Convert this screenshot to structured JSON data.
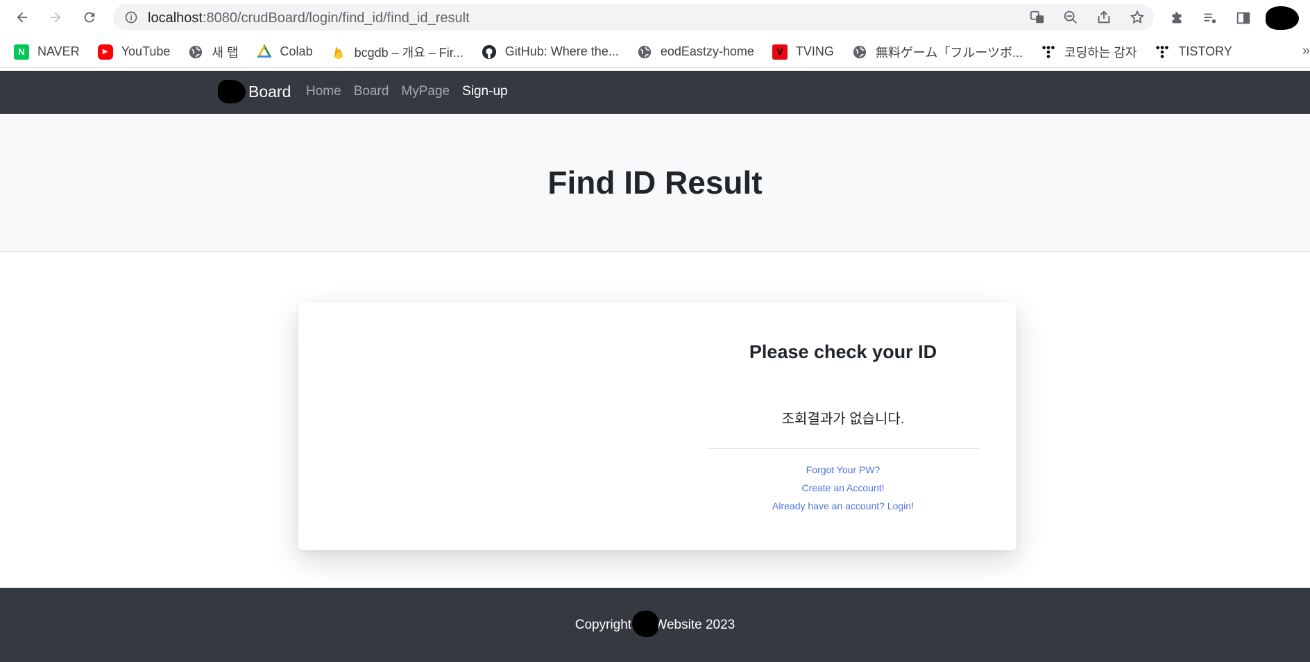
{
  "browser": {
    "url_host": "localhost",
    "url_path": ":8080/crudBoard/login/find_id/find_id_result",
    "bookmarks": [
      {
        "label": "NAVER",
        "icon": "naver-icon",
        "badge": "N",
        "color": "#03c75a"
      },
      {
        "label": "YouTube",
        "icon": "youtube-icon",
        "badge": "▶",
        "color": "#ff0000"
      },
      {
        "label": "새 탭",
        "icon": "globe-icon",
        "badge": "",
        "color": "#5f6368"
      },
      {
        "label": "Colab",
        "icon": "colab-icon",
        "badge": "",
        "color": "#f9ab00"
      },
      {
        "label": "bcgdb – 개요 – Fir...",
        "icon": "firebase-icon",
        "badge": "",
        "color": "#ffa000"
      },
      {
        "label": "GitHub: Where the...",
        "icon": "github-icon",
        "badge": "",
        "color": "#24292f"
      },
      {
        "label": "eodEastzy-home",
        "icon": "globe-icon",
        "badge": "",
        "color": "#5f6368"
      },
      {
        "label": "TVING",
        "icon": "tving-icon",
        "badge": "V",
        "color": "#e50914"
      },
      {
        "label": "無料ゲーム「フルーツボ...",
        "icon": "globe-icon",
        "badge": "",
        "color": "#5f6368"
      },
      {
        "label": "코딩하는 감자",
        "icon": "tistory-icon",
        "badge": "",
        "color": "#000000"
      },
      {
        "label": "TISTORY",
        "icon": "tistory-icon",
        "badge": "",
        "color": "#000000"
      }
    ],
    "more_label": "»"
  },
  "navbar": {
    "brand": "Board",
    "links": [
      {
        "label": "Home",
        "active": false
      },
      {
        "label": "Board",
        "active": false
      },
      {
        "label": "MyPage",
        "active": false
      },
      {
        "label": "Sign-up",
        "active": true
      }
    ]
  },
  "header": {
    "title": "Find ID Result"
  },
  "card": {
    "heading": "Please check your ID",
    "result": "조회결과가 없습니다.",
    "links": {
      "forgot_pw": "Forgot Your PW?",
      "create_account": "Create an Account!",
      "login": "Already have an account? Login!"
    }
  },
  "footer": {
    "prefix": "Copyright ©",
    "suffix": "Website 2023"
  },
  "colors": {
    "navbar_bg": "#343a40",
    "header_bg": "#f8f9fa",
    "link": "#4e73df"
  }
}
